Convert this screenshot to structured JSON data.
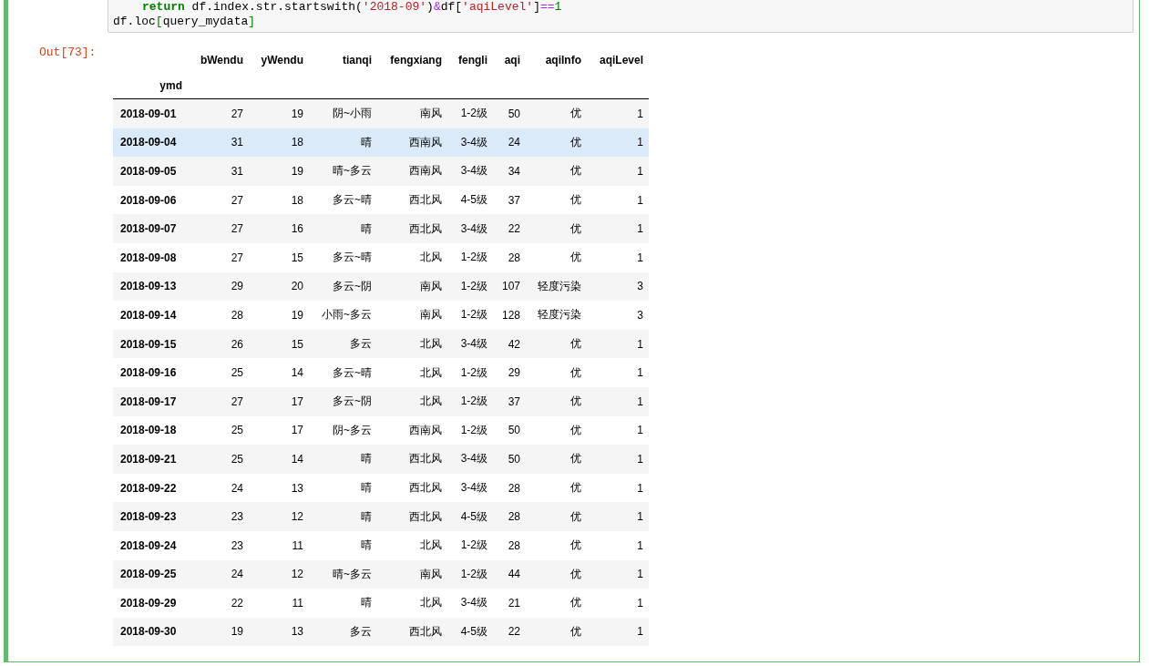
{
  "code": {
    "lines": [
      {
        "indent": true,
        "tokens": [
          {
            "kind": "keyword",
            "text": "return"
          },
          {
            "kind": "plain",
            "text": " df.index.str.startswith("
          },
          {
            "kind": "string",
            "text": "'2018-09'"
          },
          {
            "kind": "plain",
            "text": ")"
          },
          {
            "kind": "operator",
            "text": "&"
          },
          {
            "kind": "plain",
            "text": "df["
          },
          {
            "kind": "string",
            "text": "'aqiLevel'"
          },
          {
            "kind": "plain",
            "text": "]"
          },
          {
            "kind": "operator",
            "text": "=="
          },
          {
            "kind": "number",
            "text": "1"
          }
        ]
      },
      {
        "indent": false,
        "tokens": [
          {
            "kind": "plain",
            "text": "df.loc"
          },
          {
            "kind": "bracket",
            "text": "["
          },
          {
            "kind": "plain",
            "text": "query_mydata"
          },
          {
            "kind": "bracket",
            "text": "]"
          }
        ]
      }
    ]
  },
  "output": {
    "prompt": "Out[73]:",
    "table": {
      "columns": [
        "bWendu",
        "yWendu",
        "tianqi",
        "fengxiang",
        "fengli",
        "aqi",
        "aqiInfo",
        "aqiLevel"
      ],
      "index_name": "ymd",
      "rows": [
        {
          "index": "2018-09-01",
          "cells": [
            "27",
            "19",
            "阴~小雨",
            "南风",
            "1-2级",
            "50",
            "优",
            "1"
          ],
          "selected": false
        },
        {
          "index": "2018-09-04",
          "cells": [
            "31",
            "18",
            "晴",
            "西南风",
            "3-4级",
            "24",
            "优",
            "1"
          ],
          "selected": true
        },
        {
          "index": "2018-09-05",
          "cells": [
            "31",
            "19",
            "晴~多云",
            "西南风",
            "3-4级",
            "34",
            "优",
            "1"
          ],
          "selected": false
        },
        {
          "index": "2018-09-06",
          "cells": [
            "27",
            "18",
            "多云~晴",
            "西北风",
            "4-5级",
            "37",
            "优",
            "1"
          ],
          "selected": false
        },
        {
          "index": "2018-09-07",
          "cells": [
            "27",
            "16",
            "晴",
            "西北风",
            "3-4级",
            "22",
            "优",
            "1"
          ],
          "selected": false
        },
        {
          "index": "2018-09-08",
          "cells": [
            "27",
            "15",
            "多云~晴",
            "北风",
            "1-2级",
            "28",
            "优",
            "1"
          ],
          "selected": false
        },
        {
          "index": "2018-09-13",
          "cells": [
            "29",
            "20",
            "多云~阴",
            "南风",
            "1-2级",
            "107",
            "轻度污染",
            "3"
          ],
          "selected": false
        },
        {
          "index": "2018-09-14",
          "cells": [
            "28",
            "19",
            "小雨~多云",
            "南风",
            "1-2级",
            "128",
            "轻度污染",
            "3"
          ],
          "selected": false
        },
        {
          "index": "2018-09-15",
          "cells": [
            "26",
            "15",
            "多云",
            "北风",
            "3-4级",
            "42",
            "优",
            "1"
          ],
          "selected": false
        },
        {
          "index": "2018-09-16",
          "cells": [
            "25",
            "14",
            "多云~晴",
            "北风",
            "1-2级",
            "29",
            "优",
            "1"
          ],
          "selected": false
        },
        {
          "index": "2018-09-17",
          "cells": [
            "27",
            "17",
            "多云~阴",
            "北风",
            "1-2级",
            "37",
            "优",
            "1"
          ],
          "selected": false
        },
        {
          "index": "2018-09-18",
          "cells": [
            "25",
            "17",
            "阴~多云",
            "西南风",
            "1-2级",
            "50",
            "优",
            "1"
          ],
          "selected": false
        },
        {
          "index": "2018-09-21",
          "cells": [
            "25",
            "14",
            "晴",
            "西北风",
            "3-4级",
            "50",
            "优",
            "1"
          ],
          "selected": false
        },
        {
          "index": "2018-09-22",
          "cells": [
            "24",
            "13",
            "晴",
            "西北风",
            "3-4级",
            "28",
            "优",
            "1"
          ],
          "selected": false
        },
        {
          "index": "2018-09-23",
          "cells": [
            "23",
            "12",
            "晴",
            "西北风",
            "4-5级",
            "28",
            "优",
            "1"
          ],
          "selected": false
        },
        {
          "index": "2018-09-24",
          "cells": [
            "23",
            "11",
            "晴",
            "北风",
            "1-2级",
            "28",
            "优",
            "1"
          ],
          "selected": false
        },
        {
          "index": "2018-09-25",
          "cells": [
            "24",
            "12",
            "晴~多云",
            "南风",
            "1-2级",
            "44",
            "优",
            "1"
          ],
          "selected": false
        },
        {
          "index": "2018-09-29",
          "cells": [
            "22",
            "11",
            "晴",
            "北风",
            "3-4级",
            "21",
            "优",
            "1"
          ],
          "selected": false
        },
        {
          "index": "2018-09-30",
          "cells": [
            "19",
            "13",
            "多云",
            "西北风",
            "4-5级",
            "22",
            "优",
            "1"
          ],
          "selected": false
        }
      ]
    }
  }
}
